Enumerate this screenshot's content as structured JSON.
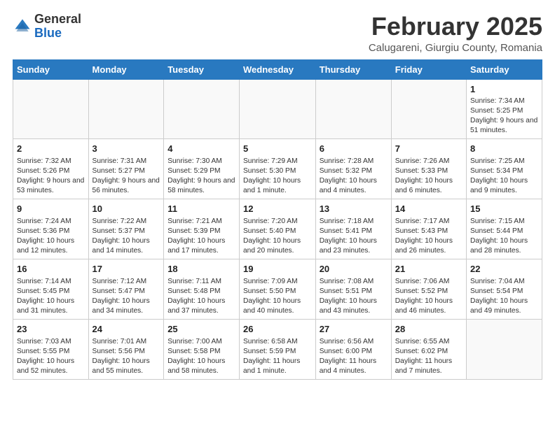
{
  "header": {
    "logo_general": "General",
    "logo_blue": "Blue",
    "title": "February 2025",
    "subtitle": "Calugareni, Giurgiu County, Romania"
  },
  "days_of_week": [
    "Sunday",
    "Monday",
    "Tuesday",
    "Wednesday",
    "Thursday",
    "Friday",
    "Saturday"
  ],
  "weeks": [
    [
      {
        "day": "",
        "info": ""
      },
      {
        "day": "",
        "info": ""
      },
      {
        "day": "",
        "info": ""
      },
      {
        "day": "",
        "info": ""
      },
      {
        "day": "",
        "info": ""
      },
      {
        "day": "",
        "info": ""
      },
      {
        "day": "1",
        "info": "Sunrise: 7:34 AM\nSunset: 5:25 PM\nDaylight: 9 hours and 51 minutes."
      }
    ],
    [
      {
        "day": "2",
        "info": "Sunrise: 7:32 AM\nSunset: 5:26 PM\nDaylight: 9 hours and 53 minutes."
      },
      {
        "day": "3",
        "info": "Sunrise: 7:31 AM\nSunset: 5:27 PM\nDaylight: 9 hours and 56 minutes."
      },
      {
        "day": "4",
        "info": "Sunrise: 7:30 AM\nSunset: 5:29 PM\nDaylight: 9 hours and 58 minutes."
      },
      {
        "day": "5",
        "info": "Sunrise: 7:29 AM\nSunset: 5:30 PM\nDaylight: 10 hours and 1 minute."
      },
      {
        "day": "6",
        "info": "Sunrise: 7:28 AM\nSunset: 5:32 PM\nDaylight: 10 hours and 4 minutes."
      },
      {
        "day": "7",
        "info": "Sunrise: 7:26 AM\nSunset: 5:33 PM\nDaylight: 10 hours and 6 minutes."
      },
      {
        "day": "8",
        "info": "Sunrise: 7:25 AM\nSunset: 5:34 PM\nDaylight: 10 hours and 9 minutes."
      }
    ],
    [
      {
        "day": "9",
        "info": "Sunrise: 7:24 AM\nSunset: 5:36 PM\nDaylight: 10 hours and 12 minutes."
      },
      {
        "day": "10",
        "info": "Sunrise: 7:22 AM\nSunset: 5:37 PM\nDaylight: 10 hours and 14 minutes."
      },
      {
        "day": "11",
        "info": "Sunrise: 7:21 AM\nSunset: 5:39 PM\nDaylight: 10 hours and 17 minutes."
      },
      {
        "day": "12",
        "info": "Sunrise: 7:20 AM\nSunset: 5:40 PM\nDaylight: 10 hours and 20 minutes."
      },
      {
        "day": "13",
        "info": "Sunrise: 7:18 AM\nSunset: 5:41 PM\nDaylight: 10 hours and 23 minutes."
      },
      {
        "day": "14",
        "info": "Sunrise: 7:17 AM\nSunset: 5:43 PM\nDaylight: 10 hours and 26 minutes."
      },
      {
        "day": "15",
        "info": "Sunrise: 7:15 AM\nSunset: 5:44 PM\nDaylight: 10 hours and 28 minutes."
      }
    ],
    [
      {
        "day": "16",
        "info": "Sunrise: 7:14 AM\nSunset: 5:45 PM\nDaylight: 10 hours and 31 minutes."
      },
      {
        "day": "17",
        "info": "Sunrise: 7:12 AM\nSunset: 5:47 PM\nDaylight: 10 hours and 34 minutes."
      },
      {
        "day": "18",
        "info": "Sunrise: 7:11 AM\nSunset: 5:48 PM\nDaylight: 10 hours and 37 minutes."
      },
      {
        "day": "19",
        "info": "Sunrise: 7:09 AM\nSunset: 5:50 PM\nDaylight: 10 hours and 40 minutes."
      },
      {
        "day": "20",
        "info": "Sunrise: 7:08 AM\nSunset: 5:51 PM\nDaylight: 10 hours and 43 minutes."
      },
      {
        "day": "21",
        "info": "Sunrise: 7:06 AM\nSunset: 5:52 PM\nDaylight: 10 hours and 46 minutes."
      },
      {
        "day": "22",
        "info": "Sunrise: 7:04 AM\nSunset: 5:54 PM\nDaylight: 10 hours and 49 minutes."
      }
    ],
    [
      {
        "day": "23",
        "info": "Sunrise: 7:03 AM\nSunset: 5:55 PM\nDaylight: 10 hours and 52 minutes."
      },
      {
        "day": "24",
        "info": "Sunrise: 7:01 AM\nSunset: 5:56 PM\nDaylight: 10 hours and 55 minutes."
      },
      {
        "day": "25",
        "info": "Sunrise: 7:00 AM\nSunset: 5:58 PM\nDaylight: 10 hours and 58 minutes."
      },
      {
        "day": "26",
        "info": "Sunrise: 6:58 AM\nSunset: 5:59 PM\nDaylight: 11 hours and 1 minute."
      },
      {
        "day": "27",
        "info": "Sunrise: 6:56 AM\nSunset: 6:00 PM\nDaylight: 11 hours and 4 minutes."
      },
      {
        "day": "28",
        "info": "Sunrise: 6:55 AM\nSunset: 6:02 PM\nDaylight: 11 hours and 7 minutes."
      },
      {
        "day": "",
        "info": ""
      }
    ]
  ]
}
